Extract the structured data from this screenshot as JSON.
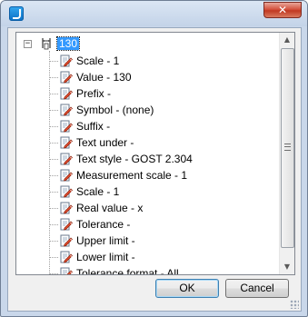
{
  "window": {
    "close_label": "✕"
  },
  "tree": {
    "root": {
      "expander": "−",
      "label": "130"
    },
    "items": [
      {
        "label": "Scale - 1"
      },
      {
        "label": "Value - 130"
      },
      {
        "label": "Prefix -"
      },
      {
        "label": "Symbol - (none)"
      },
      {
        "label": "Suffix -"
      },
      {
        "label": "Text under -"
      },
      {
        "label": "Text style - GOST 2.304"
      },
      {
        "label": "Measurement scale - 1"
      },
      {
        "label": "Scale - 1"
      },
      {
        "label": "Real value - x"
      },
      {
        "label": "Tolerance -"
      },
      {
        "label": "Upper limit -"
      },
      {
        "label": "Lower limit -"
      },
      {
        "label": "Tolerance format - All"
      }
    ]
  },
  "scrollbar": {
    "up_arrow": "▲",
    "down_arrow": "▼"
  },
  "buttons": {
    "ok_label": "OK",
    "cancel_label": "Cancel"
  },
  "icons": {
    "app": "app-icon",
    "root": "dimension-icon",
    "item": "property-edit-icon"
  },
  "colors": {
    "selection": "#3399ff",
    "frame": "#c9d7ea",
    "close_button": "#c13a22"
  }
}
